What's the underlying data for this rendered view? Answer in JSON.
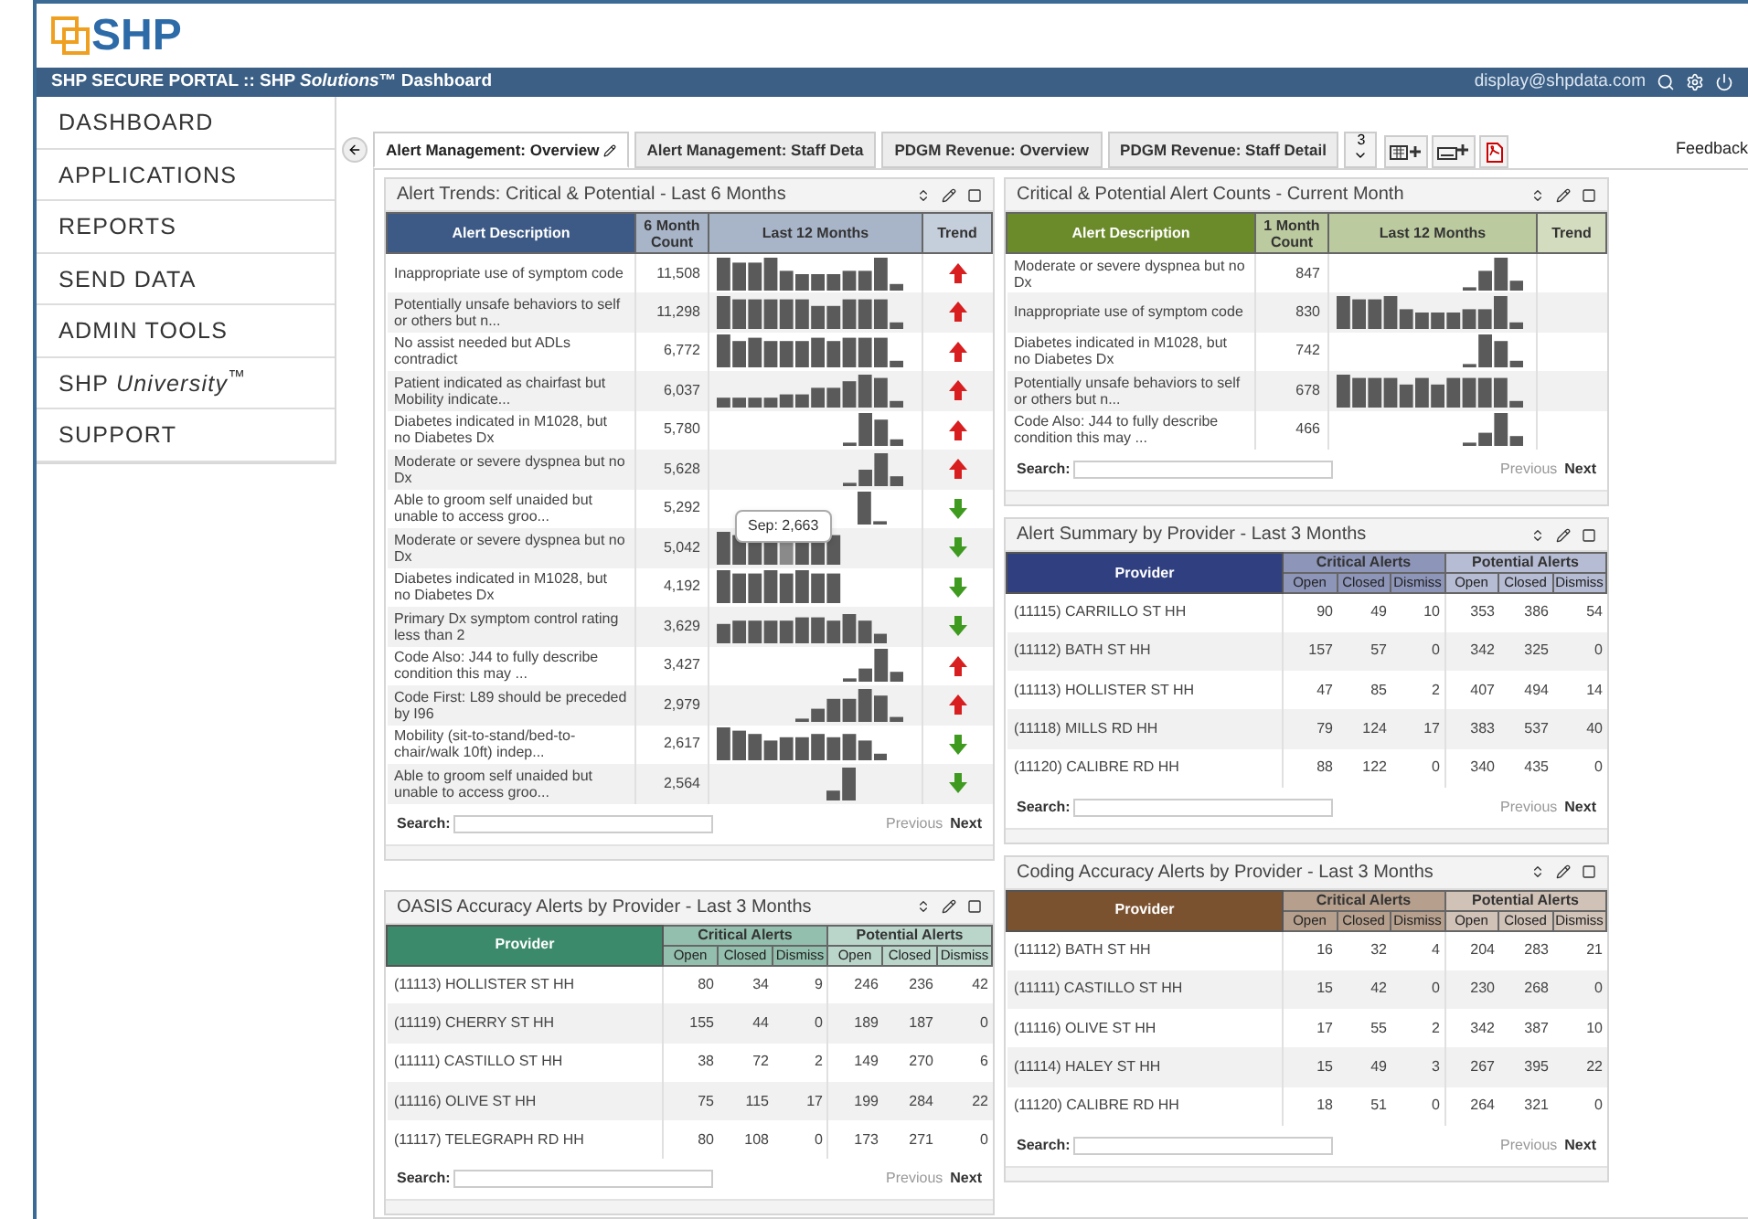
{
  "logo": "SHP",
  "header": {
    "title": "SHP SECURE PORTAL :: SHP *Solutions*™ Dashboard",
    "user": "display@shpdata.com"
  },
  "nav": [
    {
      "label": "DASHBOARD"
    },
    {
      "label": "APPLICATIONS"
    },
    {
      "label": "REPORTS"
    },
    {
      "label": "SEND DATA"
    },
    {
      "label": "ADMIN TOOLS"
    },
    {
      "label": "SHP *University*$^{™}$"
    },
    {
      "label": "SUPPORT"
    }
  ],
  "tabs": [
    {
      "label": "Alert Management: Overview",
      "selected": true
    },
    {
      "label": "Alert Management: Staff Deta",
      "selected": false
    },
    {
      "label": "PDGM Revenue: Overview",
      "selected": false
    },
    {
      "label": "PDGM Revenue: Staff Detail",
      "selected": false
    }
  ],
  "tab_count": "3",
  "feedback": "Feedback",
  "columns": [
    {
      "panels": [
        {
          "kind": "alerts",
          "title": "Alert Trends: Critical & Potential - Last 6 Months",
          "color": "#3d5a86",
          "columns": [
            "Alert Description",
            "6 Month Count",
            "Last 12 Months",
            "Trend"
          ],
          "rows": [
            {
              "description": "Inappropriate use of symptom code",
              "count": "11,508",
              "rising": true
            },
            {
              "description": "Potentially unsafe behaviors to self or others but n...",
              "count": "11,298",
              "rising": true
            },
            {
              "description": "No assist needed but ADLs contradict",
              "count": "6,772",
              "rising": true
            },
            {
              "description": "Patient indicated as chairfast but Mobility indicate...",
              "count": "6,037",
              "rising": true
            },
            {
              "description": "Diabetes indicated in M1028, but no Diabetes Dx",
              "count": "5,780",
              "rising": true
            },
            {
              "description": "Moderate or severe dyspnea but no Dx",
              "count": "5,628",
              "rising": true
            },
            {
              "description": "Able to groom self unaided but unable to access groo...",
              "count": "5,292",
              "rising": false
            },
            {
              "description": "Moderate or severe dyspnea but no Dx",
              "count": "5,042",
              "rising": false,
              "tooltip": "Sep: 2,663"
            },
            {
              "description": "Diabetes indicated in M1028, but no Diabetes Dx",
              "count": "4,192",
              "rising": false
            },
            {
              "description": "Primary Dx symptom control rating less than 2",
              "count": "3,629",
              "rising": false
            },
            {
              "description": "Code Also: J44 to fully describe condition this may ...",
              "count": "3,427",
              "rising": true
            },
            {
              "description": "Code First: L89 should be preceded by I96",
              "count": "2,979",
              "rising": true
            },
            {
              "description": "Mobility (sit-to-stand/bed-to-chair/walk 10ft) indep...",
              "count": "2,617",
              "rising": false
            },
            {
              "description": "Able to groom self unaided but unable to access groo...",
              "count": "2,564",
              "rising": false
            }
          ],
          "search_label": "Search:",
          "pagination": [
            {
              "label": "Previous",
              "disabled": true
            },
            {
              "label": "Next",
              "disabled": false
            }
          ]
        },
        {
          "kind": "providers",
          "title": "OASIS Accuracy Alerts by Provider - Last 3 Months",
          "color": "#3a8a6b",
          "provider_label": "Provider",
          "groups": [
            {
              "label": "Critical Alerts",
              "columns": [
                "Open",
                "Closed",
                "Dismiss"
              ]
            },
            {
              "label": "Potential Alerts",
              "columns": [
                "Open",
                "Closed",
                "Dismiss"
              ]
            }
          ],
          "rows": [
            {
              "provider": "(11113) HOLLISTER ST HH",
              "values": [
                "80",
                "34",
                "9",
                "246",
                "236",
                "42"
              ]
            },
            {
              "provider": "(11119) CHERRY ST HH",
              "values": [
                "155",
                "44",
                "0",
                "189",
                "187",
                "0"
              ]
            },
            {
              "provider": "(11111) CASTILLO ST HH",
              "values": [
                "38",
                "72",
                "2",
                "149",
                "270",
                "6"
              ]
            },
            {
              "provider": "(11116) OLIVE ST HH",
              "values": [
                "75",
                "115",
                "17",
                "199",
                "284",
                "22"
              ]
            },
            {
              "provider": "(11117) TELEGRAPH RD HH",
              "values": [
                "80",
                "108",
                "0",
                "173",
                "271",
                "0"
              ]
            }
          ],
          "search_label": "Search:",
          "pagination": [
            {
              "label": "Previous",
              "disabled": true
            },
            {
              "label": "Next",
              "disabled": false
            }
          ]
        }
      ]
    },
    {
      "panels": [
        {
          "kind": "alerts",
          "title": "Critical & Potential Alert Counts - Current Month",
          "color": "#6b8a2a",
          "columns": [
            "Alert Description",
            "1 Month Count",
            "Last 12 Months",
            "Trend"
          ],
          "rows": [
            {
              "description": "Moderate or severe dyspnea but no Dx",
              "count": "847"
            },
            {
              "description": "Inappropriate use of symptom code",
              "count": "830"
            },
            {
              "description": "Diabetes indicated in M1028, but no Diabetes Dx",
              "count": "742"
            },
            {
              "description": "Potentially unsafe behaviors to self or others but n...",
              "count": "678"
            },
            {
              "description": "Code Also: J44 to fully describe condition this may ...",
              "count": "466"
            }
          ],
          "search_label": "Search:",
          "pagination": [
            {
              "label": "Previous",
              "disabled": true
            },
            {
              "label": "Next",
              "disabled": false
            }
          ]
        },
        {
          "kind": "providers",
          "title": "Alert Summary by Provider - Last 3 Months",
          "color": "#2f3f80",
          "provider_label": "Provider",
          "groups": [
            {
              "label": "Critical Alerts",
              "columns": [
                "Open",
                "Closed",
                "Dismiss"
              ]
            },
            {
              "label": "Potential Alerts",
              "columns": [
                "Open",
                "Closed",
                "Dismiss"
              ]
            }
          ],
          "rows": [
            {
              "provider": "(11115) CARRILLO ST HH",
              "values": [
                "90",
                "49",
                "10",
                "353",
                "386",
                "54"
              ]
            },
            {
              "provider": "(11112) BATH ST HH",
              "values": [
                "157",
                "57",
                "0",
                "342",
                "325",
                "0"
              ]
            },
            {
              "provider": "(11113) HOLLISTER ST HH",
              "values": [
                "47",
                "85",
                "2",
                "407",
                "494",
                "14"
              ]
            },
            {
              "provider": "(11118) MILLS RD HH",
              "values": [
                "79",
                "124",
                "17",
                "383",
                "537",
                "40"
              ]
            },
            {
              "provider": "(11120) CALIBRE RD HH",
              "values": [
                "88",
                "122",
                "0",
                "340",
                "435",
                "0"
              ]
            }
          ],
          "search_label": "Search:",
          "pagination": [
            {
              "label": "Previous",
              "disabled": true
            },
            {
              "label": "Next",
              "disabled": false
            }
          ]
        },
        {
          "kind": "providers",
          "title": "Coding Accuracy Alerts by Provider - Last 3 Months",
          "color": "#7a5230",
          "provider_label": "Provider",
          "groups": [
            {
              "label": "Critical Alerts",
              "columns": [
                "Open",
                "Closed",
                "Dismiss"
              ]
            },
            {
              "label": "Potential Alerts",
              "columns": [
                "Open",
                "Closed",
                "Dismiss"
              ]
            }
          ],
          "rows": [
            {
              "provider": "(11112) BATH ST HH",
              "values": [
                "16",
                "32",
                "4",
                "204",
                "283",
                "21"
              ]
            },
            {
              "provider": "(11111) CASTILLO ST HH",
              "values": [
                "15",
                "42",
                "0",
                "230",
                "268",
                "0"
              ]
            },
            {
              "provider": "(11116) OLIVE ST HH",
              "values": [
                "17",
                "55",
                "2",
                "342",
                "387",
                "10"
              ]
            },
            {
              "provider": "(11114) HALEY ST HH",
              "values": [
                "15",
                "49",
                "3",
                "267",
                "395",
                "22"
              ]
            },
            {
              "provider": "(11120) CALIBRE RD HH",
              "values": [
                "18",
                "51",
                "0",
                "264",
                "321",
                "0"
              ]
            }
          ],
          "search_label": "Search:",
          "pagination": [
            {
              "label": "Previous",
              "disabled": true
            },
            {
              "label": "Next",
              "disabled": false
            }
          ]
        }
      ]
    }
  ]
}
